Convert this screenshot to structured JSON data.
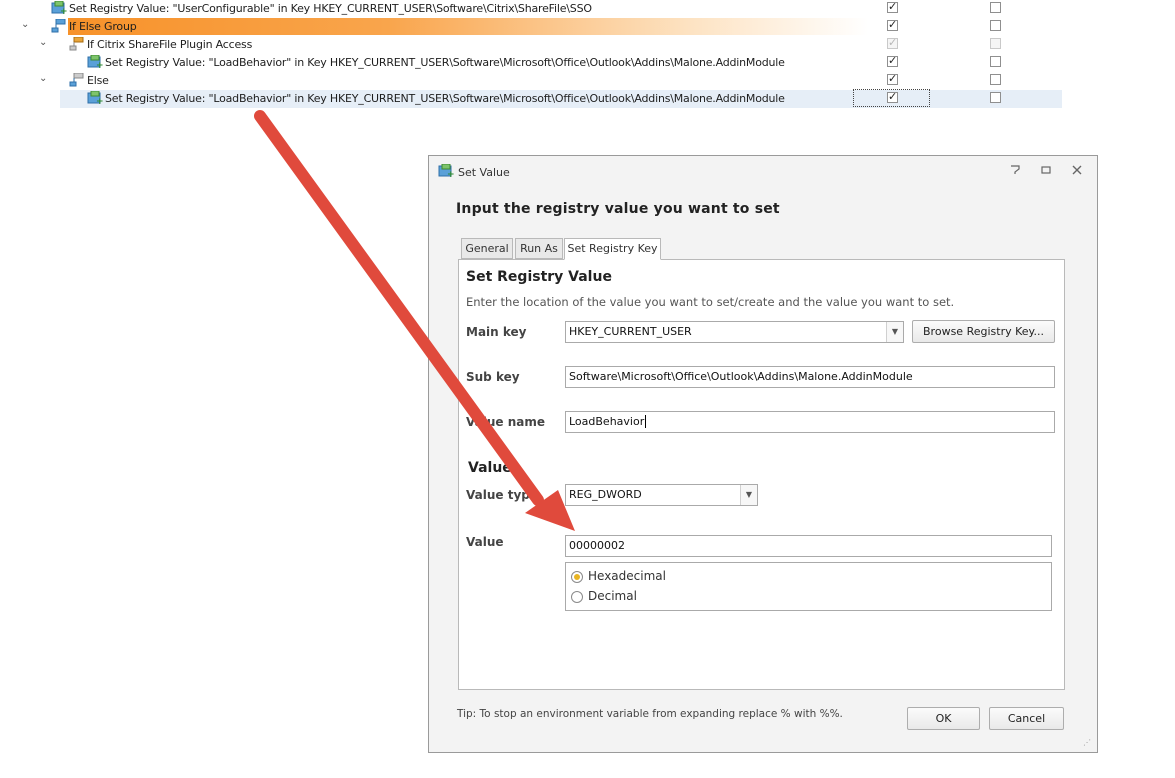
{
  "tree": {
    "rows": [
      {
        "label": "Set Registry Value: \"UserConfigurable\" in Key HKEY_CURRENT_USER\\Software\\Citrix\\ShareFile\\SSO",
        "icon": "registry-icon",
        "enabled_checked": true,
        "col2_checked": false
      },
      {
        "label": "If Else Group",
        "icon": "group-icon",
        "enabled_checked": true,
        "col2_checked": false
      },
      {
        "label": "If Citrix ShareFile Plugin Access",
        "icon": "branch-icon",
        "enabled_checked": true,
        "col2_checked": false
      },
      {
        "label": "Set Registry Value: \"LoadBehavior\" in Key HKEY_CURRENT_USER\\Software\\Microsoft\\Office\\Outlook\\Addins\\Malone.AddinModule",
        "icon": "registry-icon",
        "enabled_checked": true,
        "col2_checked": false
      },
      {
        "label": "Else",
        "icon": "branch-icon",
        "enabled_checked": true,
        "col2_checked": false
      },
      {
        "label": "Set Registry Value: \"LoadBehavior\" in Key HKEY_CURRENT_USER\\Software\\Microsoft\\Office\\Outlook\\Addins\\Malone.AddinModule",
        "icon": "registry-icon",
        "enabled_checked": true,
        "col2_checked": false
      }
    ]
  },
  "dialog": {
    "title": "Set Value",
    "heading": "Input the registry value you want to set",
    "tabs": [
      {
        "label": "General"
      },
      {
        "label": "Run As"
      },
      {
        "label": "Set Registry Key"
      }
    ],
    "active_tab": "Set Registry Key",
    "section_registry": "Set Registry Value",
    "description": "Enter the location of the value you want to set/create and the value you want to set.",
    "main_key_label": "Main key",
    "main_key_value": "HKEY_CURRENT_USER",
    "browse_button": "Browse Registry Key...",
    "sub_key_label": "Sub key",
    "sub_key_value": "Software\\Microsoft\\Office\\Outlook\\Addins\\Malone.AddinModule",
    "value_name_label": "Value name",
    "value_name_value": "LoadBehavior",
    "section_value": "Value",
    "value_type_label": "Value type",
    "value_type_value": "REG_DWORD",
    "value_label": "Value",
    "value_value": "00000002",
    "radio_hex": "Hexadecimal",
    "radio_dec": "Decimal",
    "selected_radio": "Hexadecimal",
    "tip": "Tip: To stop an environment variable from expanding replace % with %%.",
    "ok_button": "OK",
    "cancel_button": "Cancel"
  },
  "colors": {
    "group_highlight": "#f7922a",
    "annotation_arrow": "#e04a3c",
    "selected_row": "#e6eef7",
    "radio_selected": "#e8b423"
  }
}
